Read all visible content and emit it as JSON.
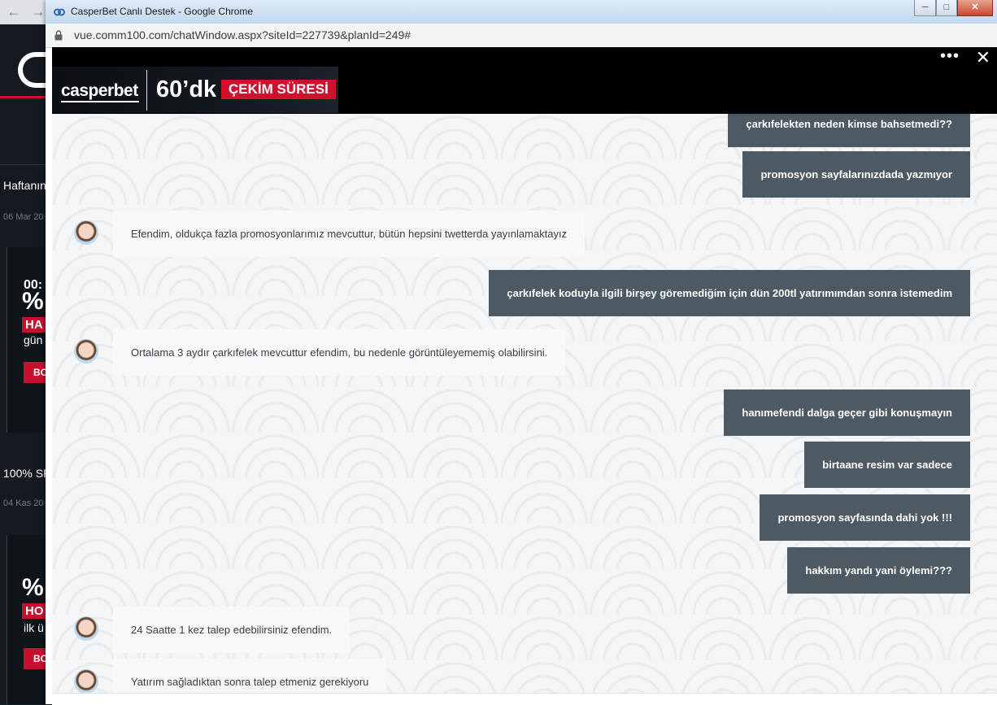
{
  "background_page": {
    "text_1": "Haftanın",
    "date_1": "06 Mar 20",
    "card_1_line_1": "00:",
    "card_1_line_2": "%",
    "card_1_line_3": "HA",
    "card_1_line_4": "gün",
    "card_1_button": "BO",
    "text_2": "100% SP",
    "date_2": "04 Kas 20",
    "card_2_line_1": "%",
    "card_2_line_2": "HO",
    "card_2_line_3": "ilk ü",
    "card_2_button": "BO"
  },
  "window": {
    "title": "CasperBet Canlı Destek - Google Chrome",
    "minimize": "─",
    "maximize": "□",
    "close": "✕"
  },
  "address": {
    "url": "vue.comm100.com/chatWindow.aspx?siteId=227739&planId=249#"
  },
  "header": {
    "logo": "casperbet",
    "banner_duration": "60’dk",
    "banner_highlight": "ÇEKİM SÜRESİ",
    "more": "•••",
    "close": "✕"
  },
  "messages": [
    {
      "sender": "user",
      "text": "çarkıfelekten neden kimse bahsetmedi??"
    },
    {
      "sender": "user",
      "text": "promosyon sayfalarınızdada yazmıyor"
    },
    {
      "sender": "agent",
      "text": "Efendim, oldukça fazla promosyonlarımız mevcuttur, bütün hepsini twetterda yayınlamaktayız"
    },
    {
      "sender": "user",
      "text": "çarkıfelek koduyla ilgili birşey göremediğim için dün 200tl yatırımımdan sonra istemedim"
    },
    {
      "sender": "agent",
      "text": "Ortalama 3 aydır çarkıfelek mevcuttur efendim, bu nedenle görüntüleyememiş olabilirsini."
    },
    {
      "sender": "user",
      "text": "hanımefendi dalga geçer gibi konuşmayın"
    },
    {
      "sender": "user",
      "text": "birtaane resim var sadece"
    },
    {
      "sender": "user",
      "text": "promosyon sayfasında dahi yok !!!"
    },
    {
      "sender": "user",
      "text": "hakkım yandı yani öylemi???"
    },
    {
      "sender": "agent",
      "text": "24 Saatte 1 kez talep edebilirsiniz efendim."
    },
    {
      "sender": "agent",
      "text": "Yatırım sağladıktan sonra talep etmeniz gerekiyoru"
    }
  ]
}
